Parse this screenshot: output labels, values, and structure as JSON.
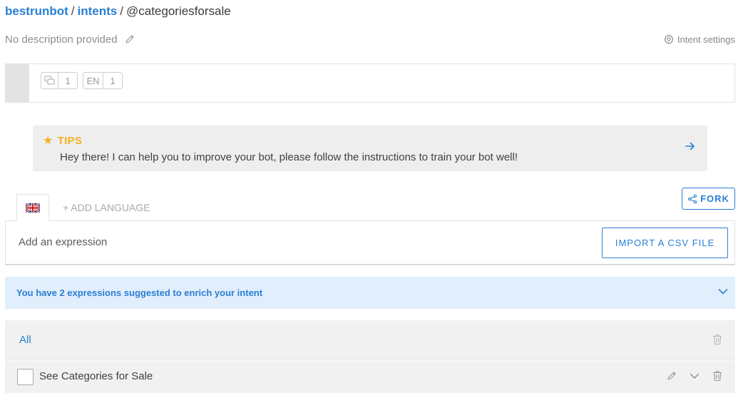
{
  "breadcrumb": {
    "bot": "bestrunbot",
    "sep1": "/",
    "section": "intents",
    "sep2": "/",
    "intent": "@categoriesforsale"
  },
  "description": {
    "text": "No description provided",
    "edit_icon": "pencil-icon"
  },
  "intent_settings": {
    "label": "Intent settings",
    "icon": "gear-icon"
  },
  "stats": {
    "expressions_icon": "chat-bubbles-icon",
    "expressions_count": "1",
    "language_code": "EN",
    "language_count": "1"
  },
  "tips": {
    "icon": "star-icon",
    "title": "TIPS",
    "text": "Hey there! I can help you to improve your bot, please follow the instructions to train your bot well!",
    "arrow_icon": "arrow-right-icon"
  },
  "language_tab": {
    "flag": "uk-flag-icon",
    "add_language": "+ ADD LANGUAGE"
  },
  "fork": {
    "label": "FORK",
    "icon": "share-icon"
  },
  "expression_input": {
    "placeholder": "Add an expression",
    "value": ""
  },
  "import_button": {
    "label": "IMPORT A CSV FILE"
  },
  "suggestions": {
    "text": "You have 2 expressions suggested to enrich your intent",
    "icon": "chevron-down-icon"
  },
  "filter": {
    "all_label": "All",
    "delete_icon": "trash-icon"
  },
  "expressions": [
    {
      "text": "See Categories for Sale",
      "checked": false
    }
  ],
  "colors": {
    "accent": "#2a7fd4",
    "tips_title": "#f5b01e",
    "suggest_bg": "#e1eefb",
    "row_bg": "#f1f1f1"
  }
}
